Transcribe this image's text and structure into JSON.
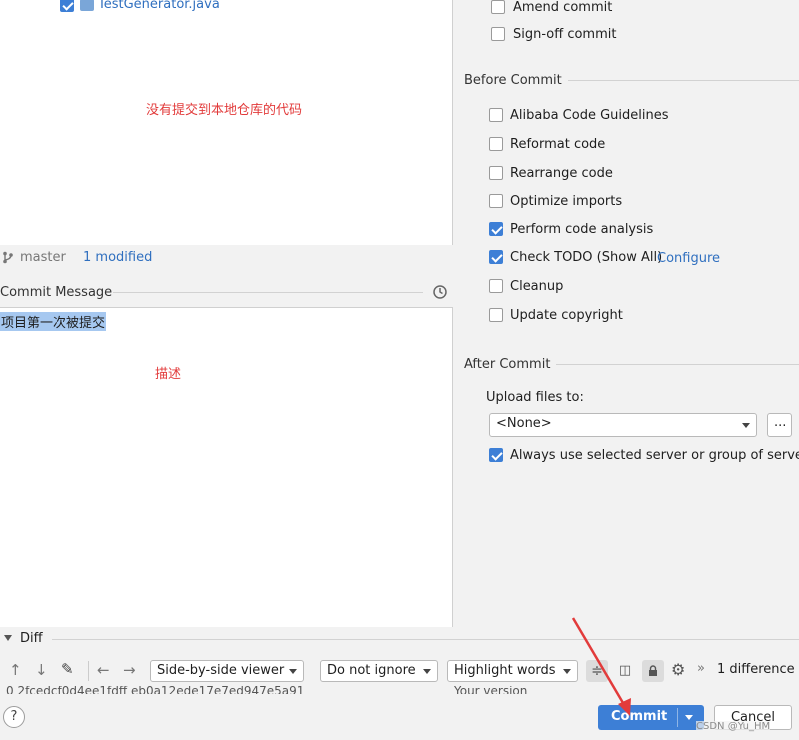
{
  "file_tree": {
    "file_name": "TestGenerator.java",
    "annotation": "没有提交到本地仓库的代码"
  },
  "status_bar": {
    "branch": "master",
    "modified": "1 modified"
  },
  "commit_message": {
    "label": "Commit Message",
    "text": "项目第一次被提交",
    "annotation": "描述"
  },
  "options": {
    "amend_commit": "Amend commit",
    "signoff_commit": "Sign-off commit",
    "before_commit_title": "Before Commit",
    "before_commit": [
      {
        "label": "Alibaba Code Guidelines",
        "checked": false
      },
      {
        "label": "Reformat code",
        "checked": false
      },
      {
        "label": "Rearrange code",
        "checked": false
      },
      {
        "label": "Optimize imports",
        "checked": false
      },
      {
        "label": "Perform code analysis",
        "checked": true
      },
      {
        "label": "Check TODO (Show All)",
        "checked": true
      },
      {
        "label": "Cleanup",
        "checked": false
      },
      {
        "label": "Update copyright",
        "checked": false
      }
    ],
    "configure_link": "Configure",
    "after_commit_title": "After Commit",
    "upload_label": "Upload files to:",
    "upload_value": "<None>",
    "more_button": "...",
    "always_use": "Always use selected server or group of servers"
  },
  "diff": {
    "title": "Diff",
    "viewer": "Side-by-side viewer",
    "whitespace": "Do not ignore",
    "highlight": "Highlight words",
    "difference_count": "1 difference",
    "hash_fragment": "0 2fcedcf0d4ee1fdff eb0a12ede17e7ed947e5a91",
    "your_version": "Your version"
  },
  "buttons": {
    "commit": "Commit",
    "cancel": "Cancel"
  },
  "watermark": "CSDN @Yu_HM",
  "colors": {
    "accent": "#3d7fd6",
    "link": "#2f6fbf",
    "annotation": "#e23b3b",
    "selection": "#a6c8f0"
  }
}
